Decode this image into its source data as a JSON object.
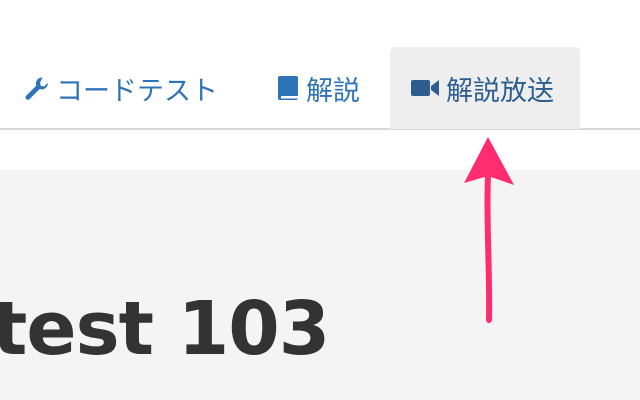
{
  "tabs": [
    {
      "label": "コードテスト",
      "icon": "wrench-icon"
    },
    {
      "label": "解説",
      "icon": "book-icon"
    },
    {
      "label": "解説放送",
      "icon": "video-camera-icon",
      "active": true
    }
  ],
  "main": {
    "title": "test 103"
  },
  "annotation": {
    "arrow_color": "#ff2d6f"
  },
  "colors": {
    "tab_text": "#2e73b8",
    "active_tab_bg": "#eeeeee",
    "content_bg": "#f4f4f4",
    "title_text": "#333333"
  }
}
